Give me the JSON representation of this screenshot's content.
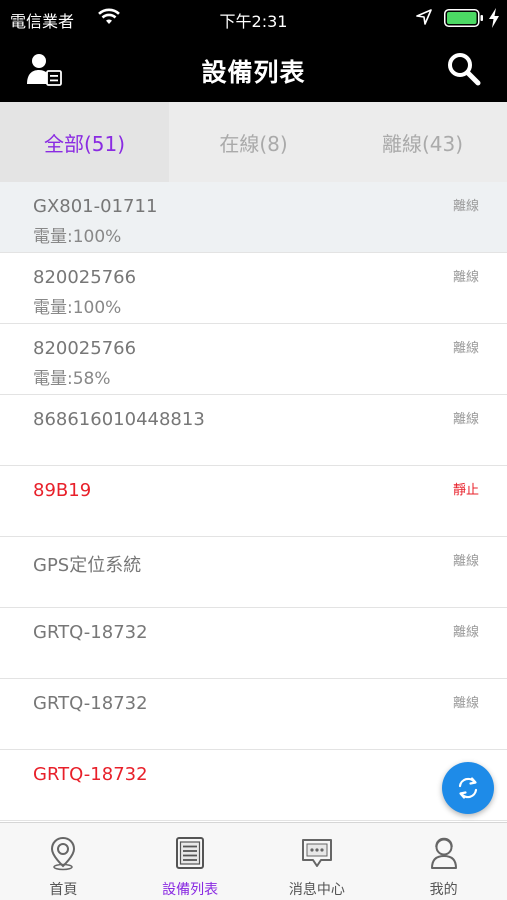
{
  "status_bar": {
    "carrier": "電信業者",
    "time": "下午2:31",
    "wifi_icon": "wifi-icon",
    "location_icon": "location-arrow-icon",
    "battery_icon": "battery-icon",
    "charging_icon": "charging-bolt-icon"
  },
  "navbar": {
    "title": "設備列表",
    "left_icon": "user-list-icon",
    "right_icon": "search-icon"
  },
  "filter_tabs": [
    {
      "label": "全部(51)",
      "active": true
    },
    {
      "label": "在線(8)",
      "active": false
    },
    {
      "label": "離線(43)",
      "active": false
    }
  ],
  "devices": [
    {
      "name": "GX801-01711",
      "battery": "電量:100%",
      "status": "離線",
      "alert": false,
      "highlight": true
    },
    {
      "name": "820025766",
      "battery": "電量:100%",
      "status": "離線",
      "alert": false,
      "highlight": false
    },
    {
      "name": "820025766",
      "battery": "電量:58%",
      "status": "離線",
      "alert": false,
      "highlight": false
    },
    {
      "name": "868616010448813",
      "battery": "",
      "status": "離線",
      "alert": false,
      "highlight": false
    },
    {
      "name": "89B19",
      "battery": "",
      "status": "靜止",
      "alert": true,
      "highlight": false
    },
    {
      "name": "GPS定位系統",
      "battery": "",
      "status": "離線",
      "alert": false,
      "highlight": false
    },
    {
      "name": "GRTQ-18732",
      "battery": "",
      "status": "離線",
      "alert": false,
      "highlight": false
    },
    {
      "name": "GRTQ-18732",
      "battery": "",
      "status": "離線",
      "alert": false,
      "highlight": false
    },
    {
      "name": "GRTQ-18732",
      "battery": "",
      "status": "",
      "alert": true,
      "highlight": false
    }
  ],
  "fab": {
    "icon": "refresh-icon"
  },
  "tab_bar": [
    {
      "label": "首頁",
      "icon": "map-pin-icon",
      "active": false
    },
    {
      "label": "設備列表",
      "icon": "device-list-icon",
      "active": true
    },
    {
      "label": "消息中心",
      "icon": "message-icon",
      "active": false
    },
    {
      "label": "我的",
      "icon": "profile-icon",
      "active": false
    }
  ],
  "colors": {
    "accent": "#8a2be2",
    "alert": "#e8202a",
    "fab": "#1e8be8",
    "battery_green": "#4cd964"
  }
}
